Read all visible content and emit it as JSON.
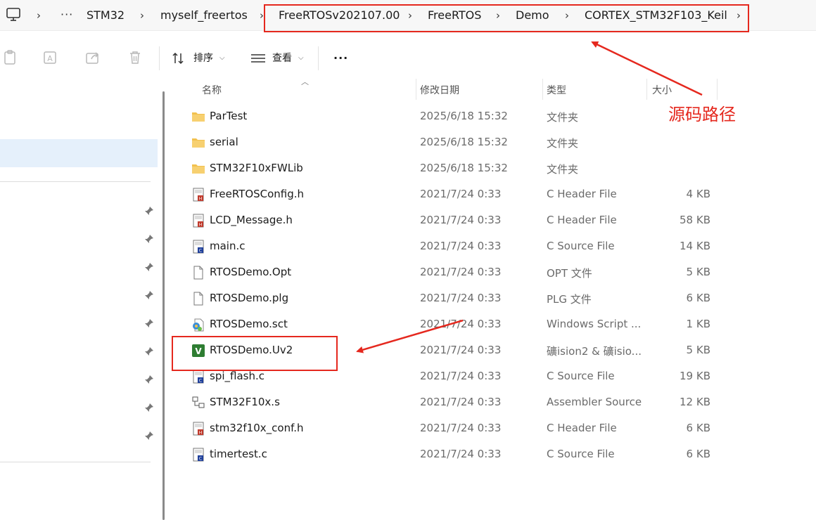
{
  "breadcrumb": {
    "items": [
      "STM32",
      "myself_freertos",
      "FreeRTOSv202107.00",
      "FreeRTOS",
      "Demo",
      "CORTEX_STM32F103_Keil"
    ],
    "overflow_label": "···"
  },
  "toolbar": {
    "sort_label": "排序",
    "view_label": "查看",
    "more_label": "···"
  },
  "columns": {
    "name": "名称",
    "modified": "修改日期",
    "type": "类型",
    "size": "大小"
  },
  "files": [
    {
      "name": "ParTest",
      "modified": "2025/6/18 15:32",
      "type": "文件夹",
      "size": "",
      "icon": "folder-icon"
    },
    {
      "name": "serial",
      "modified": "2025/6/18 15:32",
      "type": "文件夹",
      "size": "",
      "icon": "folder-icon"
    },
    {
      "name": "STM32F10xFWLib",
      "modified": "2025/6/18 15:32",
      "type": "文件夹",
      "size": "",
      "icon": "folder-icon"
    },
    {
      "name": "FreeRTOSConfig.h",
      "modified": "2021/7/24 0:33",
      "type": "C Header File",
      "size": "4 KB",
      "icon": "c-header-file-icon"
    },
    {
      "name": "LCD_Message.h",
      "modified": "2021/7/24 0:33",
      "type": "C Header File",
      "size": "58 KB",
      "icon": "c-header-file-icon"
    },
    {
      "name": "main.c",
      "modified": "2021/7/24 0:33",
      "type": "C Source File",
      "size": "14 KB",
      "icon": "c-source-file-icon"
    },
    {
      "name": "RTOSDemo.Opt",
      "modified": "2021/7/24 0:33",
      "type": "OPT 文件",
      "size": "5 KB",
      "icon": "generic-file-icon"
    },
    {
      "name": "RTOSDemo.plg",
      "modified": "2021/7/24 0:33",
      "type": "PLG 文件",
      "size": "6 KB",
      "icon": "generic-file-icon"
    },
    {
      "name": "RTOSDemo.sct",
      "modified": "2021/7/24 0:33",
      "type": "Windows Script ...",
      "size": "1 KB",
      "icon": "script-file-icon"
    },
    {
      "name": "RTOSDemo.Uv2",
      "modified": "2021/7/24 0:33",
      "type": "礦ision2 & 礦isio...",
      "size": "5 KB",
      "icon": "keil-project-icon"
    },
    {
      "name": "spi_flash.c",
      "modified": "2021/7/24 0:33",
      "type": "C Source File",
      "size": "19 KB",
      "icon": "c-source-file-icon"
    },
    {
      "name": "STM32F10x.s",
      "modified": "2021/7/24 0:33",
      "type": "Assembler Source",
      "size": "12 KB",
      "icon": "assembler-file-icon"
    },
    {
      "name": "stm32f10x_conf.h",
      "modified": "2021/7/24 0:33",
      "type": "C Header File",
      "size": "6 KB",
      "icon": "c-header-file-icon"
    },
    {
      "name": "timertest.c",
      "modified": "2021/7/24 0:33",
      "type": "C Source File",
      "size": "6 KB",
      "icon": "c-source-file-icon"
    }
  ],
  "annotation": {
    "label": "源码路径",
    "color": "#e5281e"
  },
  "colors": {
    "selection": "#e5f0fb",
    "folder": "#f2c14e"
  }
}
